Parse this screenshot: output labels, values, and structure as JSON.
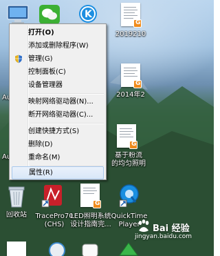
{
  "desktop": {
    "icons": [
      {
        "label": "2019210",
        "icon": "document-icon"
      },
      {
        "label": "2014年2",
        "icon": "document-icon"
      },
      {
        "label": "基于粉流\n的均匀照明",
        "icon": "document-icon"
      },
      {
        "label": "回收站",
        "icon": "recycle-bin-icon"
      },
      {
        "label": "TracePro70\n(CHS)",
        "icon": "tracepro-icon"
      },
      {
        "label": "LED照明系统\n设计指南完...",
        "icon": "document-icon"
      },
      {
        "label": "QuickTime\nPlayer",
        "icon": "quicktime-icon"
      },
      {
        "label": "Au",
        "icon": "app-icon"
      },
      {
        "label": "Au",
        "icon": "app-icon"
      }
    ]
  },
  "context_menu": {
    "items": [
      {
        "label": "打开(O)",
        "bold": true
      },
      {
        "label": "添加或删除程序(W)"
      },
      {
        "label": "管理(G)",
        "icon": "shield-icon"
      },
      {
        "label": "控制面板(C)"
      },
      {
        "label": "设备管理器"
      },
      {
        "label": "映射网络驱动器(N)..."
      },
      {
        "label": "断开网络驱动器(C)..."
      },
      {
        "label": "创建快捷方式(S)"
      },
      {
        "label": "删除(D)"
      },
      {
        "label": "重命名(M)"
      },
      {
        "label": "属性(R)",
        "highlighted": true
      }
    ]
  },
  "watermark": {
    "text": "Bai 经验",
    "url": "jingyan.baidu.com"
  },
  "colors": {
    "menu_bg": "#f0f0f0",
    "menu_border": "#979797",
    "highlight_border": "#a8c8ec",
    "badge": "#f08b1c"
  }
}
